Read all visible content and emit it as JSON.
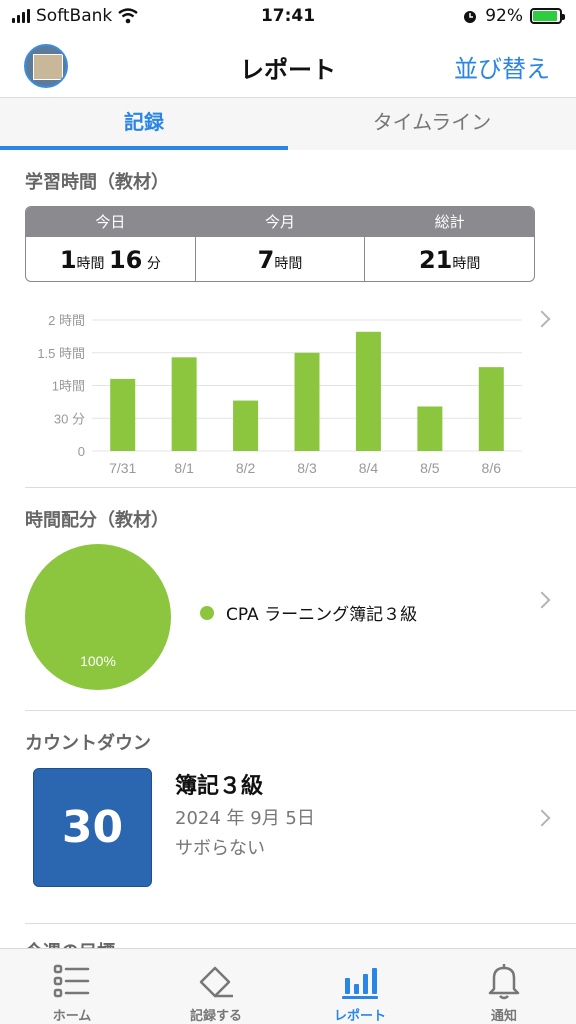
{
  "status_bar": {
    "carrier": "SoftBank",
    "time": "17:41",
    "battery": "92%",
    "battery_level": 0.92
  },
  "header": {
    "title": "レポート",
    "sort_label": "並び替え"
  },
  "tabs": [
    {
      "label": "記録",
      "active": true
    },
    {
      "label": "タイムライン",
      "active": false
    }
  ],
  "study_time": {
    "section_title": "学習時間（教材）",
    "columns": [
      {
        "header": "今日",
        "parts": [
          {
            "v": "1",
            "big": true
          },
          {
            "v": "時間",
            "big": false
          },
          {
            "v": "16",
            "big": true
          },
          {
            "v": " 分",
            "big": false
          }
        ]
      },
      {
        "header": "今月",
        "parts": [
          {
            "v": "7",
            "big": true
          },
          {
            "v": "時間",
            "big": false
          }
        ]
      },
      {
        "header": "総計",
        "parts": [
          {
            "v": "21",
            "big": true
          },
          {
            "v": "時間",
            "big": false
          }
        ]
      }
    ]
  },
  "chart_data": {
    "type": "bar",
    "categories": [
      "7/31",
      "8/1",
      "8/2",
      "8/3",
      "8/4",
      "8/5",
      "8/6"
    ],
    "values": [
      1.1,
      1.43,
      0.77,
      1.5,
      1.82,
      0.68,
      1.28
    ],
    "unit": "hours",
    "y_ticks": [
      {
        "value": 0,
        "label": "0"
      },
      {
        "value": 0.5,
        "label": "30 分"
      },
      {
        "value": 1,
        "label": "1時間"
      },
      {
        "value": 1.5,
        "label": "1.5 時間"
      },
      {
        "value": 2,
        "label": "2 時間"
      }
    ],
    "ylim": [
      0,
      2
    ],
    "color": "#8cc63f",
    "grid": true
  },
  "distribution": {
    "section_title": "時間配分（教材）",
    "slices": [
      {
        "label": "CPA ラーニング簿記３級",
        "percent": 100,
        "percent_label": "100%",
        "color": "#8cc63f"
      }
    ]
  },
  "countdown": {
    "section_title": "カウントダウン",
    "days": "30",
    "name": "簿記３級",
    "date": "2024 年 9月 5日",
    "note": "サボらない"
  },
  "next_section_title": "今週の目標",
  "tabbar": [
    {
      "label": "ホーム",
      "icon": "list-icon",
      "active": false
    },
    {
      "label": "記録する",
      "icon": "pencil-icon",
      "active": false
    },
    {
      "label": "レポート",
      "icon": "bar-chart-icon",
      "active": true
    },
    {
      "label": "通知",
      "icon": "bell-icon",
      "active": false
    }
  ],
  "colors": {
    "accent": "#2a86e6",
    "bar": "#8cc63f",
    "countdown": "#2b66b0"
  }
}
